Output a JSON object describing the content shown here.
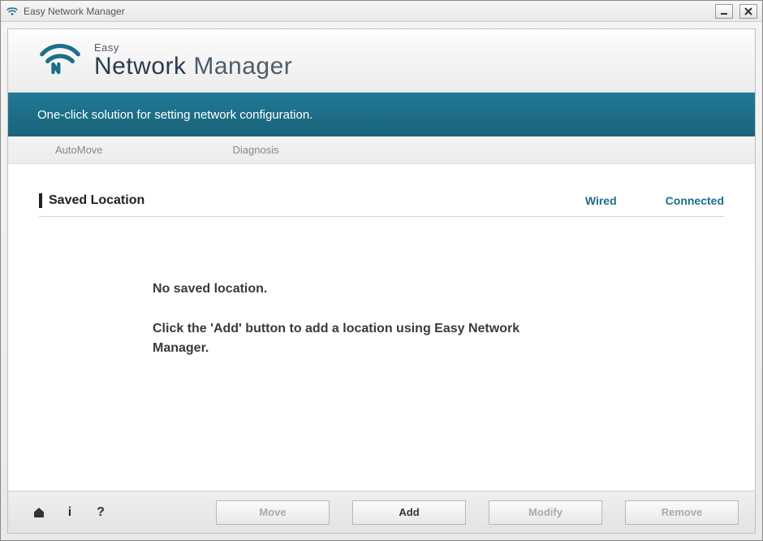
{
  "window": {
    "title": "Easy Network Manager"
  },
  "logo": {
    "small": "Easy",
    "big_bold": "Network ",
    "big_thin": "Manager"
  },
  "tagline": "One-click solution for setting network configuration.",
  "tabs": {
    "automove": "AutoMove",
    "diagnosis": "Diagnosis"
  },
  "section": {
    "title": "Saved Location",
    "status_type": "Wired",
    "status_state": "Connected"
  },
  "empty": {
    "line1": "No saved location.",
    "line2": "Click the 'Add' button to add a location using Easy Network Manager."
  },
  "footer": {
    "move": "Move",
    "add": "Add",
    "modify": "Modify",
    "remove": "Remove"
  }
}
